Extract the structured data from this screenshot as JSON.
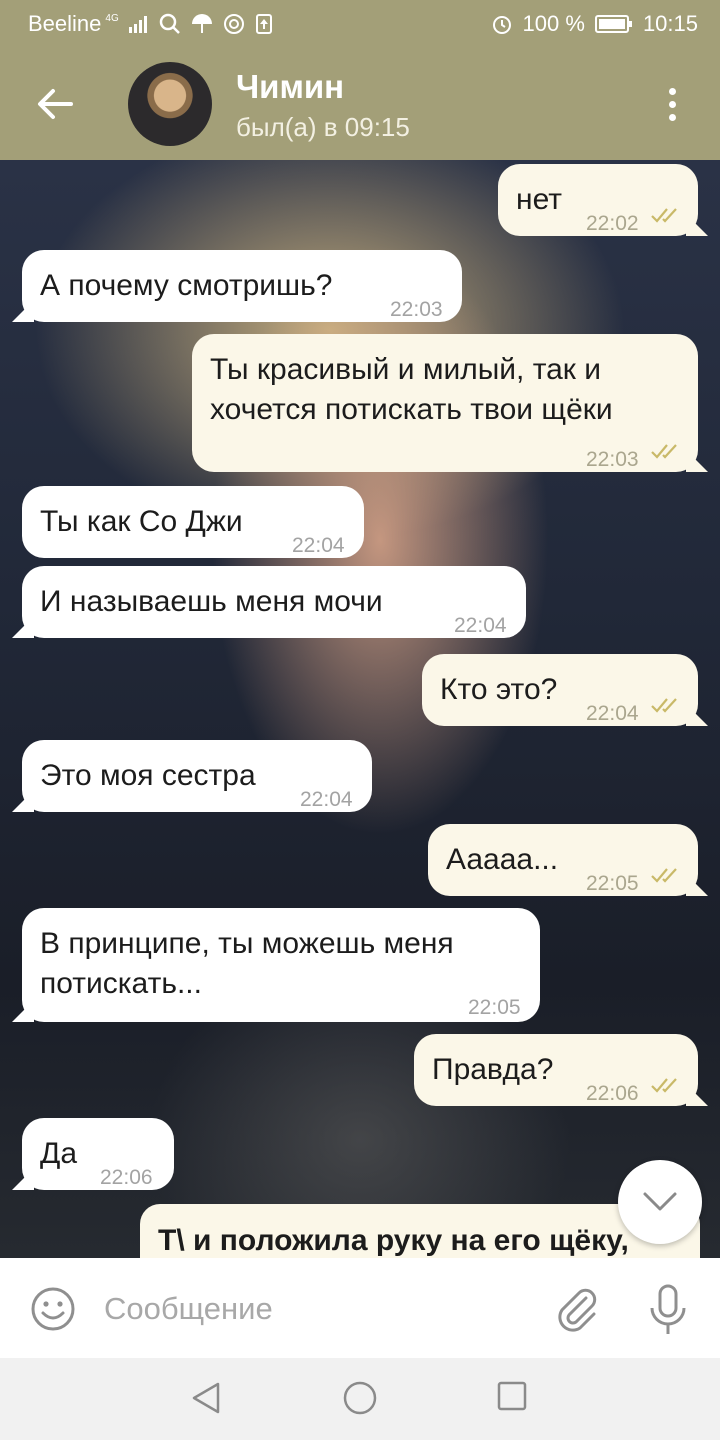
{
  "status_bar": {
    "carrier": "Beeline",
    "network": "4G",
    "battery": "100 %",
    "time": "10:15"
  },
  "header": {
    "contact_name": "Чимин",
    "last_seen": "был(а) в 09:15"
  },
  "messages": [
    {
      "dir": "out",
      "text": "нет",
      "time": "22:02"
    },
    {
      "dir": "in",
      "text": "А почему смотришь?",
      "time": "22:03"
    },
    {
      "dir": "out",
      "text_lines": [
        "Ты красивый и милый, так и",
        "хочется потискать твои щёки"
      ],
      "time": "22:03"
    },
    {
      "dir": "in",
      "text": "Ты как Со Джи",
      "time": "22:04"
    },
    {
      "dir": "in",
      "text": "И называешь меня мочи",
      "time": "22:04"
    },
    {
      "dir": "out",
      "text": "Кто это?",
      "time": "22:04"
    },
    {
      "dir": "in",
      "text": "Это моя сестра",
      "time": "22:04"
    },
    {
      "dir": "out",
      "text": "Ааааа...",
      "time": "22:05"
    },
    {
      "dir": "in",
      "text_lines": [
        "В принципе, ты можешь меня",
        "потискать..."
      ],
      "time": "22:05"
    },
    {
      "dir": "out",
      "text": "Правда?",
      "time": "22:06"
    },
    {
      "dir": "in",
      "text": "Да",
      "time": "22:06"
    },
    {
      "dir": "out",
      "text": "Т\\ и положила руку на его щёку,"
    }
  ],
  "composer": {
    "placeholder": "Сообщение"
  },
  "colors": {
    "header": "#a39f78",
    "incoming_bubble": "#ffffff",
    "outgoing_bubble": "#fbf7e8",
    "read_checks": "#c9b968"
  }
}
